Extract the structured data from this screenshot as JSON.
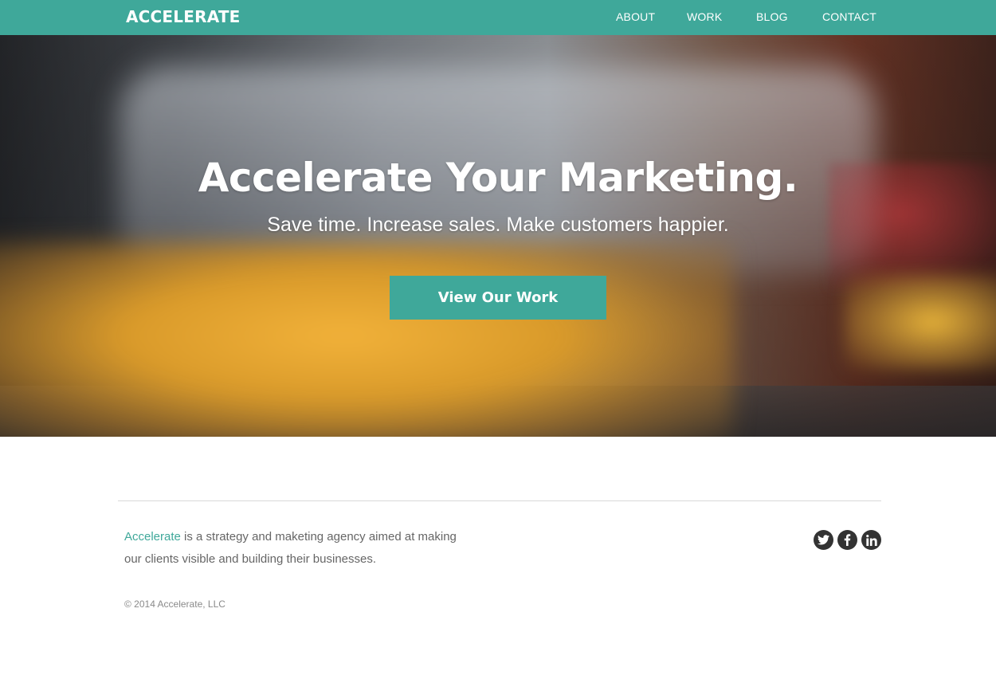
{
  "nav": {
    "brand": "ACCELERATE",
    "links": [
      "ABOUT",
      "WORK",
      "BLOG",
      "CONTACT"
    ]
  },
  "hero": {
    "title": "Accelerate Your Marketing.",
    "subtitle": "Save time. Increase sales. Make customers happier.",
    "button_label": "View Our Work"
  },
  "footer": {
    "about_link": "Accelerate",
    "about_text": " is a strategy and maketing agency aimed at making our clients visible and building their businesses.",
    "copyright": "© 2014 Accelerate, LLC",
    "social_icons": [
      "twitter-icon",
      "facebook-icon",
      "linkedin-icon"
    ]
  },
  "colors": {
    "accent": "#3fa89a",
    "icon": "#333333"
  }
}
